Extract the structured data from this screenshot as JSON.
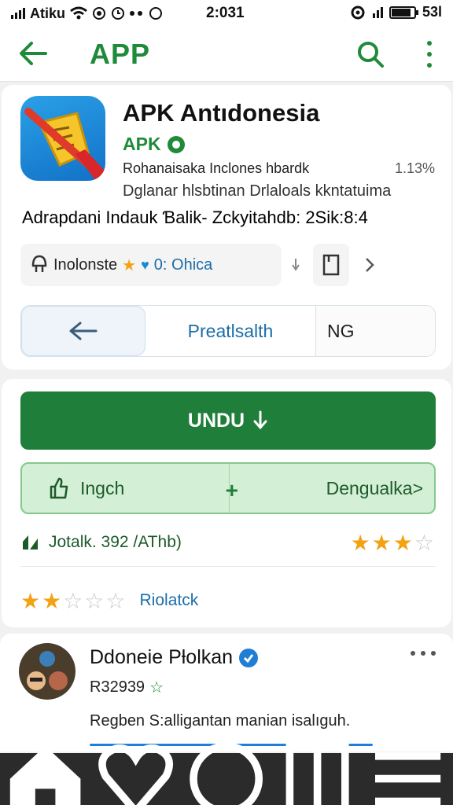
{
  "status_bar": {
    "carrier": "Atiku",
    "clock": "2:031",
    "battery_text": "53l"
  },
  "app_bar": {
    "title": "APP",
    "icons": [
      "back-arrow-icon",
      "search-icon",
      "more-vert-icon"
    ],
    "accent": "#1f8a3a"
  },
  "app_info": {
    "name": "APK Antıdonesia",
    "developer": "APK",
    "line1": "Rohanaisaka Inclones hbardk",
    "percent": "1.13%",
    "line2": "Dglanar hlsbtinan Drlaloals kkntatuima",
    "line3": "Adrapdani Indauk Ɓalik- Zckyitahdb: 2Sik:8:4"
  },
  "chip": {
    "label": "Inolonste",
    "value": "0: Ohica"
  },
  "segments": {
    "middle": "Preatlsalth",
    "right": "NG"
  },
  "actions": {
    "install_label": "UNDU",
    "left_label": "Ingch",
    "right_label": "Dengualka>",
    "primary_color": "#1f7e3a"
  },
  "stats": {
    "total_text": "Jotalk. 392 /AThb)",
    "rating_stars": 3.5,
    "my_rating_stars": 1.5,
    "rating_label": "Riolatck"
  },
  "review": {
    "author": "Ddoneie Pƚolkan",
    "meta": "R32939",
    "text": "Regben S:alligantan manian isalıguh."
  },
  "nav_bar": {
    "icons": [
      "home-icon",
      "heart-icon",
      "circle-icon",
      "book-icon",
      "menu-icon"
    ]
  }
}
